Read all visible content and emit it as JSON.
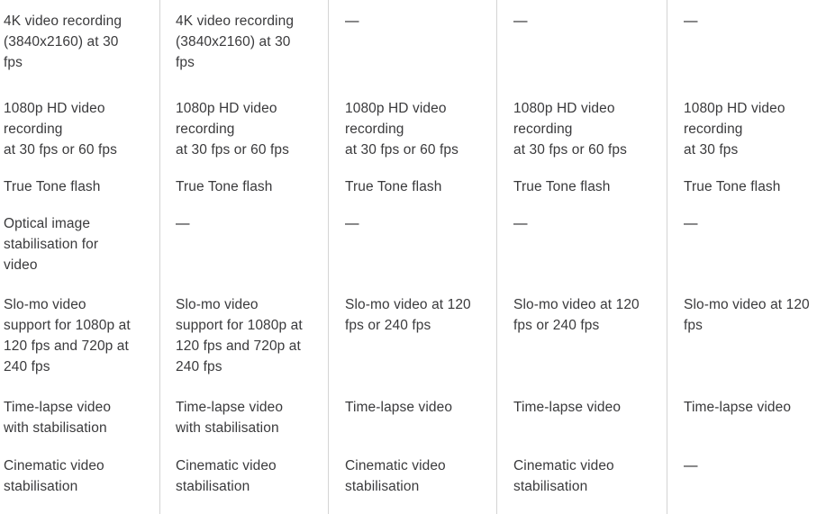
{
  "table": {
    "divider_color": "#d4d4d4",
    "text_color": "#3a3a3c",
    "dash_color": "#1d1d1f",
    "background": "#ffffff",
    "row_labels": [
      "4k-video-recording",
      "1080p-hd-video-recording",
      "true-tone-flash",
      "optical-image-stabilisation-for-video",
      "slo-mo-video-support",
      "time-lapse-video",
      "cinematic-video-stabilisation"
    ],
    "columns": [
      {
        "id": "column-1",
        "cells": [
          "4K video recording\n(3840x2160) at 30\nfps",
          "1080p HD video\nrecording\nat 30 fps or 60 fps",
          "True Tone flash",
          "Optical image\nstabilisation for\nvideo",
          "Slo-mo video\nsupport for 1080p at\n120 fps and 720p at\n240 fps",
          "Time-lapse video\nwith stabilisation",
          "Cinematic video\nstabilisation"
        ]
      },
      {
        "id": "column-2",
        "cells": [
          "4K video recording\n(3840x2160) at 30\nfps",
          "1080p HD video\nrecording\nat 30 fps or 60 fps",
          "True Tone flash",
          "—",
          "Slo-mo video\nsupport for 1080p at\n120 fps and 720p at\n240 fps",
          "Time-lapse video\nwith stabilisation",
          "Cinematic video\nstabilisation"
        ]
      },
      {
        "id": "column-3",
        "cells": [
          "—",
          "1080p HD video\nrecording\nat 30 fps or 60 fps",
          "True Tone flash",
          "—",
          "Slo-mo video at 120\nfps or 240 fps",
          "Time-lapse video",
          "Cinematic video\nstabilisation"
        ]
      },
      {
        "id": "column-4",
        "cells": [
          "—",
          "1080p HD video\nrecording\nat 30 fps or 60 fps",
          "True Tone flash",
          "—",
          "Slo-mo video at 120\nfps or 240 fps",
          "Time-lapse video",
          "Cinematic video\nstabilisation"
        ]
      },
      {
        "id": "column-5",
        "cells": [
          "—",
          "1080p HD video\nrecording\nat 30 fps",
          "True Tone flash",
          "—",
          "Slo-mo video at 120\nfps",
          "Time-lapse video",
          "—"
        ]
      }
    ]
  }
}
